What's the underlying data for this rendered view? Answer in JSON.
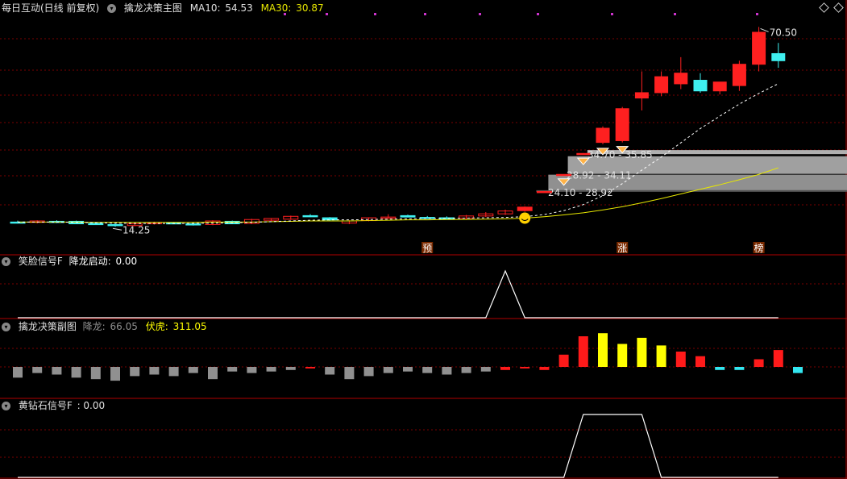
{
  "main": {
    "stock": "每日互动(日线 前复权)",
    "indicator": "擒龙决策主图",
    "ma10_label": "MA10:",
    "ma10_value": "54.53",
    "ma30_label": "MA30:",
    "ma30_value": "30.87",
    "high_label": "70.50",
    "low_label": "14.25",
    "zones": [
      "34.70 - 35.85",
      "28.92 - 34.11",
      "24.10 - 28.92"
    ],
    "markers": [
      "预",
      "涨",
      "榜"
    ]
  },
  "sub1": {
    "title": "笑脸信号F",
    "name": "降龙启动:",
    "value": "0.00"
  },
  "sub2": {
    "title": "擒龙决策副图",
    "name1": "降龙:",
    "value1": "66.05",
    "name2": "伏虎:",
    "value2": "311.05"
  },
  "sub3": {
    "title": "黄钻石信号F",
    "value": ": 0.00"
  },
  "colors": {
    "up": "#ff2020",
    "down": "#3ff0f0",
    "ma30": "#e8e800",
    "grid": "#7a0000",
    "yellow": "#ffff00",
    "gray": "#909090",
    "pink": "#cc33cc"
  },
  "chart_data": [
    {
      "type": "candlestick",
      "title": "擒龙决策主图",
      "series": [
        {
          "name": "MA10",
          "value": 54.53
        },
        {
          "name": "MA30",
          "value": 30.87
        }
      ],
      "candles": [
        {
          "o": 15.6,
          "h": 16.0,
          "l": 15.2,
          "c": 15.4
        },
        {
          "o": 15.5,
          "h": 16.1,
          "l": 15.2,
          "c": 15.9
        },
        {
          "o": 15.8,
          "h": 16.1,
          "l": 15.3,
          "c": 15.5
        },
        {
          "o": 15.8,
          "h": 16.0,
          "l": 15.0,
          "c": 15.1
        },
        {
          "o": 15.2,
          "h": 15.4,
          "l": 14.8,
          "c": 14.9
        },
        {
          "o": 14.9,
          "h": 15.2,
          "l": 14.25,
          "c": 14.6
        },
        {
          "o": 14.6,
          "h": 15.3,
          "l": 14.4,
          "c": 15.1
        },
        {
          "o": 15.1,
          "h": 15.7,
          "l": 14.9,
          "c": 15.5
        },
        {
          "o": 15.4,
          "h": 15.6,
          "l": 15.0,
          "c": 15.1
        },
        {
          "o": 15.1,
          "h": 15.4,
          "l": 14.6,
          "c": 14.8
        },
        {
          "o": 14.9,
          "h": 16.1,
          "l": 14.7,
          "c": 15.9
        },
        {
          "o": 15.8,
          "h": 16.0,
          "l": 15.0,
          "c": 15.1
        },
        {
          "o": 15.2,
          "h": 16.5,
          "l": 15.0,
          "c": 16.3
        },
        {
          "o": 16.1,
          "h": 16.7,
          "l": 15.9,
          "c": 16.6
        },
        {
          "o": 16.4,
          "h": 17.4,
          "l": 16.2,
          "c": 17.2
        },
        {
          "o": 17.4,
          "h": 17.8,
          "l": 17.0,
          "c": 17.1
        },
        {
          "o": 16.8,
          "h": 17.0,
          "l": 16.0,
          "c": 16.2
        },
        {
          "o": 15.3,
          "h": 16.1,
          "l": 15.0,
          "c": 15.9
        },
        {
          "o": 16.0,
          "h": 16.9,
          "l": 15.8,
          "c": 16.8
        },
        {
          "o": 16.9,
          "h": 17.8,
          "l": 16.7,
          "c": 17.0
        },
        {
          "o": 17.4,
          "h": 17.7,
          "l": 16.9,
          "c": 17.0
        },
        {
          "o": 16.9,
          "h": 17.3,
          "l": 16.6,
          "c": 16.8
        },
        {
          "o": 16.8,
          "h": 17.2,
          "l": 16.5,
          "c": 16.7
        },
        {
          "o": 16.7,
          "h": 17.6,
          "l": 16.5,
          "c": 17.3
        },
        {
          "o": 17.3,
          "h": 18.4,
          "l": 17.0,
          "c": 17.9
        },
        {
          "o": 17.9,
          "h": 19.1,
          "l": 17.6,
          "c": 18.7
        },
        {
          "o": 18.8,
          "h": 20.0,
          "l": 18.5,
          "c": 19.8
        },
        {
          "o": 24.1,
          "h": 24.2,
          "l": 24.1,
          "c": 24.2
        },
        {
          "o": 28.9,
          "h": 29.0,
          "l": 28.9,
          "c": 29.0
        },
        {
          "o": 34.7,
          "h": 35.0,
          "l": 34.7,
          "c": 34.9
        },
        {
          "o": 38.0,
          "h": 42.5,
          "l": 37.5,
          "c": 42.0
        },
        {
          "o": 38.5,
          "h": 48.0,
          "l": 38.0,
          "c": 47.5
        },
        {
          "o": 50.5,
          "h": 58.0,
          "l": 47.0,
          "c": 52.0
        },
        {
          "o": 52.0,
          "h": 58.0,
          "l": 51.0,
          "c": 56.5
        },
        {
          "o": 54.5,
          "h": 62.0,
          "l": 53.0,
          "c": 57.5
        },
        {
          "o": 55.5,
          "h": 57.5,
          "l": 52.0,
          "c": 52.5
        },
        {
          "o": 52.5,
          "h": 55.0,
          "l": 51.5,
          "c": 55.0
        },
        {
          "o": 54.0,
          "h": 61.0,
          "l": 52.5,
          "c": 60.0
        },
        {
          "o": 60.0,
          "h": 70.5,
          "l": 58.0,
          "c": 69.0
        },
        {
          "o": 63.0,
          "h": 66.0,
          "l": 59.0,
          "c": 61.0
        }
      ],
      "ma30": [
        15.6,
        15.6,
        15.6,
        15.6,
        15.5,
        15.5,
        15.5,
        15.5,
        15.5,
        15.5,
        15.6,
        15.6,
        15.6,
        15.7,
        15.8,
        15.9,
        15.9,
        15.9,
        16.0,
        16.1,
        16.2,
        16.2,
        16.3,
        16.3,
        16.4,
        16.5,
        16.7,
        17.1,
        17.6,
        18.2,
        19.0,
        19.9,
        21.0,
        22.2,
        23.5,
        24.8,
        26.1,
        27.5,
        29.0,
        30.87
      ],
      "ma10": [
        15.6,
        15.6,
        15.6,
        15.5,
        15.4,
        15.3,
        15.2,
        15.2,
        15.2,
        15.2,
        15.3,
        15.4,
        15.5,
        15.7,
        15.9,
        16.1,
        16.2,
        16.2,
        16.3,
        16.4,
        16.5,
        16.6,
        16.6,
        16.7,
        16.8,
        16.9,
        17.1,
        17.7,
        18.8,
        20.5,
        23.0,
        26.4,
        30.2,
        33.9,
        37.9,
        41.9,
        45.4,
        48.8,
        51.8,
        54.53
      ],
      "signals": {
        "smile_index": 26,
        "diamond_indices": [
          28,
          29,
          30,
          31
        ]
      }
    },
    {
      "type": "line",
      "title": "笑脸信号F",
      "series": [
        {
          "name": "降龙启动",
          "values": [
            0,
            0,
            0,
            0,
            0,
            0,
            0,
            0,
            0,
            0,
            0,
            0,
            0,
            0,
            0,
            0,
            0,
            0,
            0,
            0,
            0,
            0,
            0,
            0,
            0,
            1,
            0,
            0,
            0,
            0,
            0,
            0,
            0,
            0,
            0,
            0,
            0,
            0,
            0,
            0
          ]
        }
      ]
    },
    {
      "type": "bar",
      "title": "擒龙决策副图",
      "series": [
        {
          "name": "降龙",
          "value": 66.05
        },
        {
          "name": "伏虎",
          "value": 311.05
        }
      ],
      "values": [
        -35,
        -20,
        -25,
        -35,
        -40,
        -45,
        -30,
        -25,
        -30,
        -20,
        -40,
        -15,
        -20,
        -15,
        -10,
        -5,
        -25,
        -40,
        -30,
        -20,
        -15,
        -20,
        -25,
        -20,
        -15,
        -10,
        -5,
        -10,
        40,
        100,
        110,
        75,
        95,
        70,
        50,
        35,
        -10,
        -10,
        25,
        55,
        -20
      ],
      "colors": [
        "gray",
        "gray",
        "gray",
        "gray",
        "gray",
        "gray",
        "gray",
        "gray",
        "gray",
        "gray",
        "gray",
        "gray",
        "gray",
        "gray",
        "gray",
        "red",
        "gray",
        "gray",
        "gray",
        "gray",
        "gray",
        "gray",
        "gray",
        "gray",
        "gray",
        "red",
        "red",
        "red",
        "red",
        "red",
        "yellow",
        "yellow",
        "yellow",
        "yellow",
        "red",
        "red",
        "cyan",
        "cyan",
        "red",
        "red",
        "cyan"
      ]
    },
    {
      "type": "line",
      "title": "黄钻石信号F",
      "series": [
        {
          "name": "黄钻石信号F",
          "values": [
            0,
            0,
            0,
            0,
            0,
            0,
            0,
            0,
            0,
            0,
            0,
            0,
            0,
            0,
            0,
            0,
            0,
            0,
            0,
            0,
            0,
            0,
            0,
            0,
            0,
            0,
            0,
            0,
            0,
            1,
            1,
            1,
            1,
            0,
            0,
            0,
            0,
            0,
            0,
            0
          ]
        }
      ]
    }
  ]
}
